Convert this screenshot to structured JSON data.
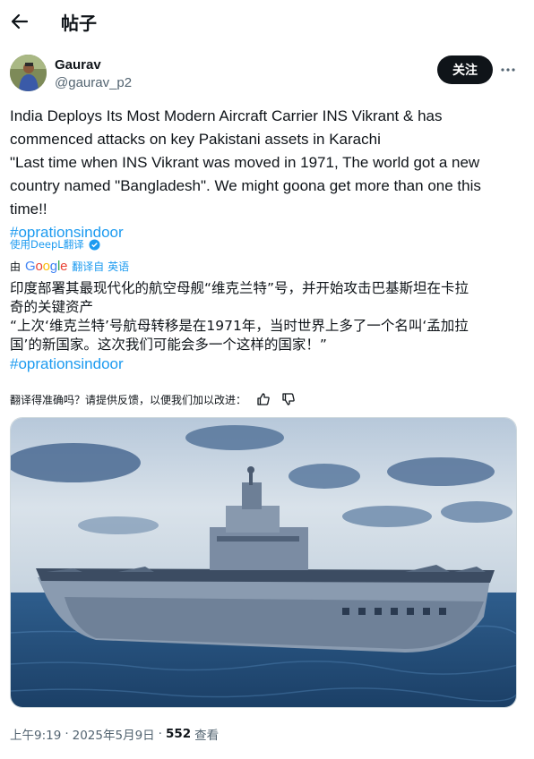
{
  "header": {
    "title": "帖子",
    "back_icon": "arrow-left-icon"
  },
  "author": {
    "display_name": "Gaurav",
    "handle": "@gaurav_p2",
    "follow_label": "关注",
    "more_icon": "more-horizontal-icon"
  },
  "tweet": {
    "lines": [
      "India Deploys Its Most Modern Aircraft Carrier INS Vikrant & has",
      "commenced attacks on key Pakistani assets in Karachi",
      "\"Last time when INS Vikrant was moved in 1971, The world got a new",
      "country named \"Bangladesh\". We might goona get more than one this",
      "time!!"
    ],
    "hashtag": "#oprationsindoor"
  },
  "translate": {
    "deepl_label": "使用DeepL翻译",
    "by_label": "由",
    "google_label": "Google",
    "translated_from": "翻译自 英语"
  },
  "translation": {
    "lines": [
      "印度部署其最现代化的航空母舰“维克兰特”号，并开始攻击巴基斯坦在卡拉",
      "奇的关键资产",
      "“上次‘维克兰特’号航母转移是在1971年，当时世界上多了一个名叫‘孟加拉",
      "国’的新国家。这次我们可能会多一个这样的国家！”"
    ],
    "hashtag": "#oprationsindoor"
  },
  "feedback": {
    "prompt": "翻译得准确吗？请提供反馈，以便我们加以改进：",
    "thumbs_up_icon": "thumbs-up-icon",
    "thumbs_down_icon": "thumbs-down-icon"
  },
  "meta": {
    "time": "上午9:19",
    "sep1": "·",
    "date": "2025年5月9日",
    "sep2": "·",
    "views": "552",
    "views_label": "查看"
  },
  "colors": {
    "link": "#1d9bf0",
    "button_bg": "#0f1419",
    "secondary_text": "#536471",
    "border": "#cfd9de"
  }
}
